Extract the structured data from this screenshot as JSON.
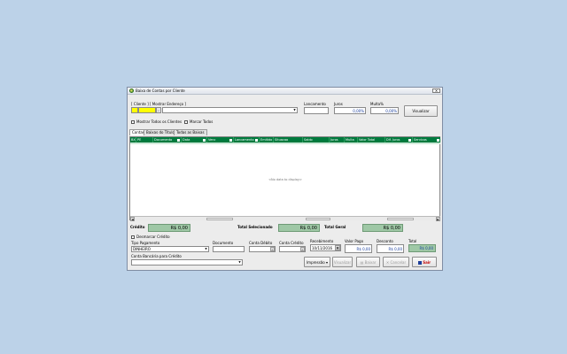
{
  "window": {
    "title": "Baixa de Contas por Cliente",
    "close": "✕"
  },
  "filters": {
    "cliente_label": "[ Cliente ]   [ Mostrar Endereço ]",
    "cliente_code": "",
    "lancamento_label": "Lancamento",
    "lancamento_value": "",
    "juros_label": "Juros",
    "juros_value": "0,00%",
    "multa_label": "Multa%",
    "multa_value": "0,00%",
    "visualizar": "Visualizar"
  },
  "checks": {
    "mostrar_todos": "Mostrar Todos os Clientes",
    "marcar_todos": "Marcar Todos"
  },
  "tabs": [
    "Contas",
    "Baixas do Título",
    "Todas as Baixas"
  ],
  "grid": {
    "columns": [
      "BX",
      "PE",
      "Documento",
      "Data",
      "Venc",
      "Lancamento",
      "Emitido",
      "Situacao",
      "Saldo",
      "Juros",
      "Multa",
      "Valor Total",
      "Dif. Juros",
      "Servicos"
    ],
    "empty_text": "<No data to display>"
  },
  "totals": {
    "credito_label": "Crédito",
    "credito_value": "R$ 0,00",
    "selecionado_label": "Total Selecionado",
    "selecionado_value": "R$ 0,00",
    "geral_label": "Total Geral",
    "geral_value": "R$ 0,00"
  },
  "payment": {
    "desmarcar_credito": "Desmarcar Crédito",
    "tipo_label": "Tipo Pagamento",
    "tipo_value": "DINHEIRO",
    "documento_label": "Documento",
    "documento_value": "",
    "conta_debito_label": "Conta Débito",
    "conta_credito_label": "Conta Crédito",
    "recebimento_label": "Recebimento",
    "recebimento_value": "10/11/2016",
    "valor_pago_label": "Valor Pago",
    "valor_pago_value": "R$ 0,00",
    "desconto_label": "Desconto",
    "desconto_value": "R$ 0,00",
    "total_label": "Total",
    "total_value": "R$ 0,00",
    "conta_bancaria_label": "Conta Bancária para Crédito"
  },
  "actions": {
    "impressao": "Impressão",
    "visualizar": "Visualizar",
    "baixar": "Baixar",
    "cancelar": "Cancelar",
    "sair": "Sair"
  },
  "colors": {
    "grid_header": "#007a3d",
    "money_bg": "#9fc8a6",
    "desktop": "#bcd2e8",
    "cliente_highlight": "#ffff00"
  }
}
